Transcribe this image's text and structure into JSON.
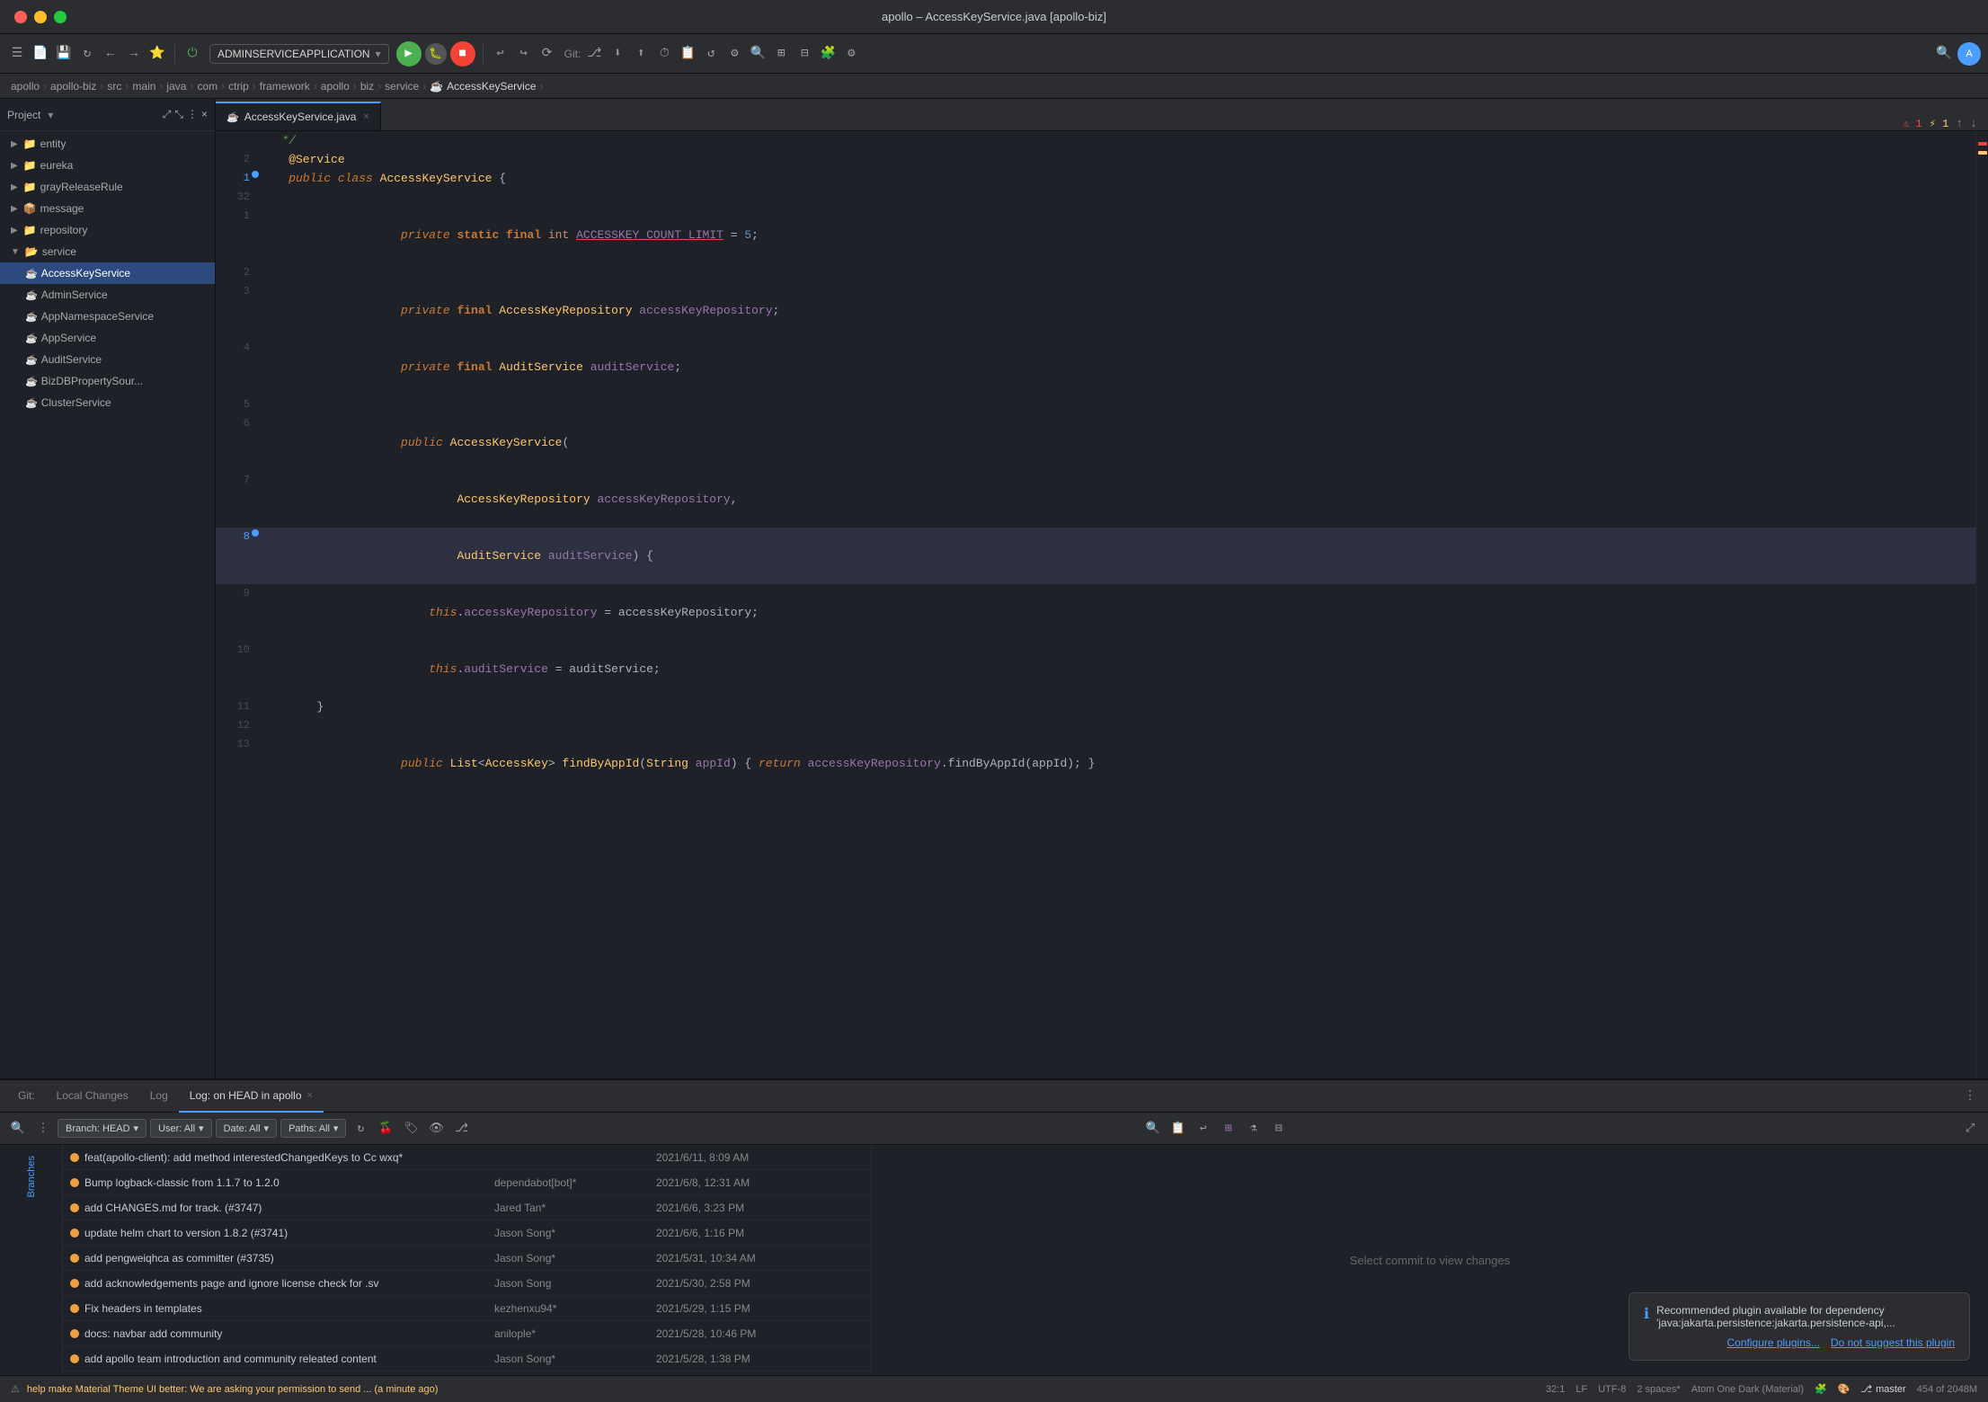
{
  "window": {
    "title": "apollo – AccessKeyService.java [apollo-biz]",
    "controls": [
      "close",
      "minimize",
      "maximize"
    ]
  },
  "toolbar": {
    "run_config": "ADMINSERVICEAPPLICATION",
    "git_label": "Git:"
  },
  "breadcrumb": {
    "items": [
      "apollo",
      "apollo-biz",
      "src",
      "main",
      "java",
      "com",
      "ctrip",
      "framework",
      "apollo",
      "biz",
      "service",
      "AccessKeyService"
    ]
  },
  "sidebar": {
    "header": "Project",
    "items": [
      {
        "label": "entity",
        "type": "folder",
        "level": 1,
        "expanded": false
      },
      {
        "label": "eureka",
        "type": "folder",
        "level": 1,
        "expanded": false
      },
      {
        "label": "grayReleaseRule",
        "type": "folder",
        "level": 1,
        "expanded": false
      },
      {
        "label": "message",
        "type": "folder",
        "level": 1,
        "expanded": false
      },
      {
        "label": "repository",
        "type": "folder",
        "level": 1,
        "expanded": false
      },
      {
        "label": "service",
        "type": "folder",
        "level": 1,
        "expanded": true
      },
      {
        "label": "AccessKeyService",
        "type": "java",
        "level": 2,
        "selected": true
      },
      {
        "label": "AdminService",
        "type": "java",
        "level": 2
      },
      {
        "label": "AppNamespaceService",
        "type": "java",
        "level": 2
      },
      {
        "label": "AppService",
        "type": "java",
        "level": 2
      },
      {
        "label": "AuditService",
        "type": "java",
        "level": 2
      },
      {
        "label": "BizDBPropertySource",
        "type": "java",
        "level": 2
      },
      {
        "label": "ClusterService",
        "type": "java",
        "level": 2
      }
    ]
  },
  "editor": {
    "tab": "AccessKeyService.java",
    "error_count": 1,
    "warning_count": 1,
    "lines": [
      {
        "num": "",
        "content": "   */",
        "class": "comment"
      },
      {
        "num": "2",
        "content": "    @Service",
        "class": "annotation"
      },
      {
        "num": "1",
        "content": "    public class AccessKeyService {",
        "class": "code",
        "has_gutter_icon": true
      },
      {
        "num": "32",
        "content": "",
        "class": "blank"
      },
      {
        "num": "1",
        "content": "        private static final int ACCESSKEY_COUNT_LIMIT = 5;",
        "class": "code"
      },
      {
        "num": "2",
        "content": "",
        "class": "blank"
      },
      {
        "num": "3",
        "content": "        private final AccessKeyRepository accessKeyRepository;",
        "class": "code"
      },
      {
        "num": "4",
        "content": "        private final AuditService auditService;",
        "class": "code"
      },
      {
        "num": "5",
        "content": "",
        "class": "blank"
      },
      {
        "num": "6",
        "content": "        public AccessKeyService(",
        "class": "code"
      },
      {
        "num": "7",
        "content": "                AccessKeyRepository accessKeyRepository,",
        "class": "code"
      },
      {
        "num": "8",
        "content": "                AuditService auditService) {",
        "class": "code",
        "has_gutter_icon": true
      },
      {
        "num": "9",
        "content": "            this.accessKeyRepository = accessKeyRepository;",
        "class": "code"
      },
      {
        "num": "10",
        "content": "            this.auditService = auditService;",
        "class": "code"
      },
      {
        "num": "11",
        "content": "        }",
        "class": "code"
      },
      {
        "num": "12",
        "content": "",
        "class": "blank"
      },
      {
        "num": "13",
        "content": "        public List<AccessKey> findByAppId(String appId) { return accessKeyRepository.findByAppId(appId); }",
        "class": "code"
      }
    ]
  },
  "bottom_panel": {
    "git_tab": "Git:",
    "local_changes_tab": "Local Changes",
    "log_tab": "Log",
    "log_on_head_tab": "Log: on HEAD in apollo",
    "filters": {
      "branch": "Branch: HEAD",
      "user": "User: All",
      "date": "Date: All",
      "paths": "Paths: All"
    },
    "commits": [
      {
        "message": "feat(apollo-client): add method interestedChangedKeys to Cc wxq*",
        "author": "",
        "date": "2021/6/11, 8:09 AM",
        "dot_color": "#f0a040"
      },
      {
        "message": "Bump logback-classic from 1.1.7 to 1.2.0",
        "author": "dependabot[bot]*",
        "date": "2021/6/8, 12:31 AM",
        "dot_color": "#f0a040"
      },
      {
        "message": "add CHANGES.md for track. (#3747)",
        "author": "Jared Tan*",
        "date": "2021/6/6, 3:23 PM",
        "dot_color": "#f0a040"
      },
      {
        "message": "update helm chart to version 1.8.2 (#3741)",
        "author": "Jason Song*",
        "date": "2021/6/6, 1:16 PM",
        "dot_color": "#f0a040"
      },
      {
        "message": "add pengweiqhca as committer (#3735)",
        "author": "Jason Song*",
        "date": "2021/5/31, 10:34 AM",
        "dot_color": "#f0a040"
      },
      {
        "message": "add acknowledgements page and ignore license check for .sv",
        "author": "Jason Song",
        "date": "2021/5/30, 2:58 PM",
        "dot_color": "#f0a040"
      },
      {
        "message": "Fix headers in templates",
        "author": "kezhenxu94*",
        "date": "2021/5/29, 1:15 PM",
        "dot_color": "#f0a040"
      },
      {
        "message": "docs: navbar add community",
        "author": "anilople*",
        "date": "2021/5/28, 10:46 PM",
        "dot_color": "#f0a040"
      },
      {
        "message": "add apollo team introduction and community releated content",
        "author": "Jason Song*",
        "date": "2021/5/28, 1:38 PM",
        "dot_color": "#f0a040"
      }
    ],
    "select_commit_msg": "Select commit to view changes"
  },
  "plugin_notification": {
    "message": "Recommended plugin available for dependency 'java:jakarta.persistence:jakarta.persistence-api,...",
    "configure_label": "Configure plugins...",
    "dismiss_label": "Do not suggest this plugin"
  },
  "status_bar": {
    "git_branch": "master",
    "line_col": "32:1",
    "line_sep": "LF",
    "encoding": "UTF-8",
    "indent": "2 spaces*",
    "theme": "Atom One Dark (Material)",
    "warning_msg": "help make Material Theme UI better: We are asking your permission to send ... (a minute ago)",
    "memory": "454 of 2048M"
  }
}
